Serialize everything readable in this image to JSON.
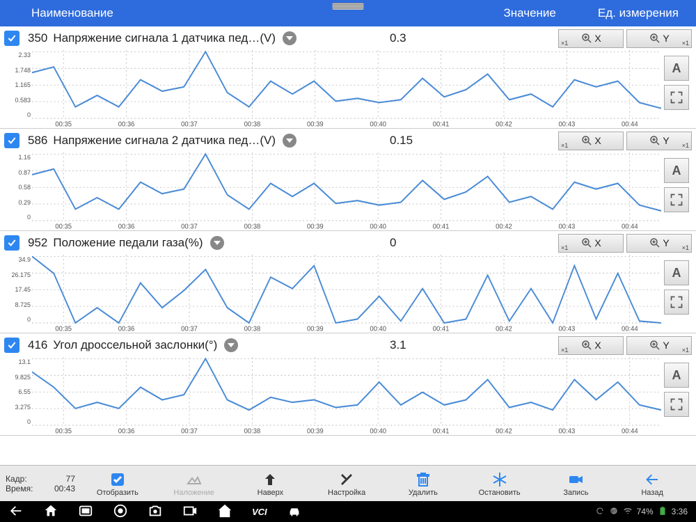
{
  "header": {
    "name": "Наименование",
    "value": "Значение",
    "unit": "Ед. измерения"
  },
  "rows": [
    {
      "id": "350",
      "title": "Напряжение сигнала 1 датчика пед…(V)",
      "value": "0.3",
      "ylabels": [
        "2.33",
        "1.748",
        "1.165",
        "0.583",
        "0"
      ],
      "xlabels": [
        "00:35",
        "00:36",
        "00:37",
        "00:38",
        "00:39",
        "00:40",
        "00:41",
        "00:42",
        "00:43",
        "00:44"
      ]
    },
    {
      "id": "586",
      "title": "Напряжение сигнала 2 датчика пед…(V)",
      "value": "0.15",
      "ylabels": [
        "1.16",
        "0.87",
        "0.58",
        "0.29",
        "0"
      ],
      "xlabels": [
        "00:35",
        "00:36",
        "00:37",
        "00:38",
        "00:39",
        "00:40",
        "00:41",
        "00:42",
        "00:43",
        "00:44"
      ]
    },
    {
      "id": "952",
      "title": "Положение педали газа(%)",
      "value": "0",
      "ylabels": [
        "34.9",
        "26.175",
        "17.45",
        "8.725",
        "0"
      ],
      "xlabels": [
        "00:35",
        "00:36",
        "00:37",
        "00:38",
        "00:39",
        "00:40",
        "00:41",
        "00:42",
        "00:43",
        "00:44"
      ]
    },
    {
      "id": "416",
      "title": "Угол дроссельной заслонки(°)",
      "value": "3.1",
      "ylabels": [
        "13.1",
        "9.825",
        "6.55",
        "3.275",
        "0"
      ],
      "xlabels": [
        "00:35",
        "00:36",
        "00:37",
        "00:38",
        "00:39",
        "00:40",
        "00:41",
        "00:42",
        "00:43",
        "00:44"
      ]
    }
  ],
  "zoom": {
    "x": "X",
    "y": "Y",
    "scale": "×1"
  },
  "side": {
    "a": "A"
  },
  "footer1": {
    "kadr_label": "Кадр:",
    "kadr_val": "77",
    "time_label": "Время:",
    "time_val": "00:43",
    "buttons": [
      {
        "label": "Отобразить",
        "k": "show",
        "col": "#2e87f0"
      },
      {
        "label": "Наложение",
        "k": "overlay",
        "col": "#aaa",
        "dis": true
      },
      {
        "label": "Наверх",
        "k": "up",
        "col": "#333"
      },
      {
        "label": "Настройка",
        "k": "settings",
        "col": "#333"
      },
      {
        "label": "Удалить",
        "k": "delete",
        "col": "#2e87f0"
      },
      {
        "label": "Остановить",
        "k": "freeze",
        "col": "#2e87f0"
      },
      {
        "label": "Запись",
        "k": "record",
        "col": "#2e87f0"
      },
      {
        "label": "Назад",
        "k": "back",
        "col": "#2e87f0"
      }
    ]
  },
  "sysbar": {
    "batt": "74%",
    "time": "3:36",
    "vci": "VCI"
  },
  "chart_data": [
    {
      "type": "line",
      "title": "Напряжение сигнала 1 датчика пед…(V)",
      "ylim": [
        0,
        2.33
      ],
      "x": [
        "00:35",
        "00:36",
        "00:37",
        "00:38",
        "00:39",
        "00:40",
        "00:41",
        "00:42",
        "00:43",
        "00:44"
      ],
      "values": [
        1.6,
        1.8,
        0.4,
        0.8,
        0.4,
        1.35,
        0.95,
        1.1,
        2.33,
        0.9,
        0.4,
        1.3,
        0.85,
        1.3,
        0.6,
        0.7,
        0.55,
        0.65,
        1.4,
        0.75,
        1.0,
        1.55,
        0.65,
        0.85,
        0.4,
        1.35,
        1.1,
        1.3,
        0.55,
        0.35
      ]
    },
    {
      "type": "line",
      "title": "Напряжение сигнала 2 датчика пед…(V)",
      "ylim": [
        0,
        1.16
      ],
      "x": [
        "00:35",
        "00:36",
        "00:37",
        "00:38",
        "00:39",
        "00:40",
        "00:41",
        "00:42",
        "00:43",
        "00:44"
      ],
      "values": [
        0.8,
        0.9,
        0.2,
        0.4,
        0.2,
        0.67,
        0.47,
        0.55,
        1.16,
        0.45,
        0.2,
        0.65,
        0.42,
        0.65,
        0.3,
        0.35,
        0.27,
        0.32,
        0.7,
        0.37,
        0.5,
        0.77,
        0.32,
        0.42,
        0.2,
        0.67,
        0.55,
        0.65,
        0.27,
        0.17
      ]
    },
    {
      "type": "line",
      "title": "Положение педали газа(%)",
      "ylim": [
        0,
        34.9
      ],
      "x": [
        "00:35",
        "00:36",
        "00:37",
        "00:38",
        "00:39",
        "00:40",
        "00:41",
        "00:42",
        "00:43",
        "00:44"
      ],
      "values": [
        34.9,
        26,
        0,
        8,
        0,
        21,
        8,
        17,
        28,
        8,
        0,
        24,
        18,
        30,
        0,
        2,
        14,
        1,
        18,
        0,
        2,
        25,
        1,
        18,
        0,
        30,
        2,
        26,
        1,
        0
      ]
    },
    {
      "type": "line",
      "title": "Угол дроссельной заслонки(°)",
      "ylim": [
        0,
        13.1
      ],
      "x": [
        "00:35",
        "00:36",
        "00:37",
        "00:38",
        "00:39",
        "00:40",
        "00:41",
        "00:42",
        "00:43",
        "00:44"
      ],
      "values": [
        10.5,
        7.5,
        3.3,
        4.5,
        3.3,
        7.5,
        5,
        6,
        13.1,
        5,
        3,
        5.5,
        4.5,
        5,
        3.5,
        4,
        8.5,
        4,
        6.5,
        4,
        5,
        9,
        3.5,
        4.5,
        3,
        9,
        5,
        8.5,
        4,
        3
      ]
    }
  ]
}
